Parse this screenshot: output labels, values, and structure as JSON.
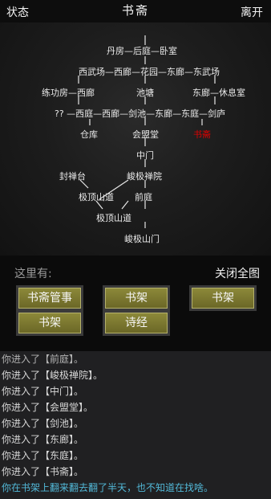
{
  "header": {
    "status_label": "状态",
    "title": "书斋",
    "leave_label": "离开"
  },
  "map": {
    "nodes": {
      "danfang": "丹房—后庭—卧室",
      "row2": "西武场—西廊—花园—东廊—东武场",
      "lianggong": "练功房—西廊",
      "chitang": "池塘",
      "dongting_rest": "东廊—休息室",
      "row4": "?? —西庭—西廊—剑池—东廊—东庭—剑庐",
      "cangku": "仓库",
      "huimengtang": "会盟堂",
      "shuzhai": "书斋",
      "zhongmen": "中门",
      "fengchan": "封禅台",
      "junji": "峻极禅院",
      "jiding_shandao": "极顶山道",
      "qianting": "前庭",
      "junji_shandao": "极顶山道",
      "junji_shanmen": "峻极山门"
    },
    "current_color": "#e00000"
  },
  "here": {
    "label": "这里有:",
    "close_map_label": "关闭全图",
    "buttons": [
      "书斋管事",
      "书架",
      "书架",
      "书架",
      "诗经"
    ]
  },
  "log": {
    "lines": [
      "你进入了【前庭】。",
      "你进入了【峻极禅院】。",
      "你进入了【中门】。",
      "你进入了【会盟堂】。",
      "你进入了【剑池】。",
      "你进入了【东廊】。",
      "你进入了【东庭】。",
      "你进入了【书斋】。"
    ],
    "last": "你在书架上翻来翻去翻了半天，也不知道在找啥。"
  }
}
